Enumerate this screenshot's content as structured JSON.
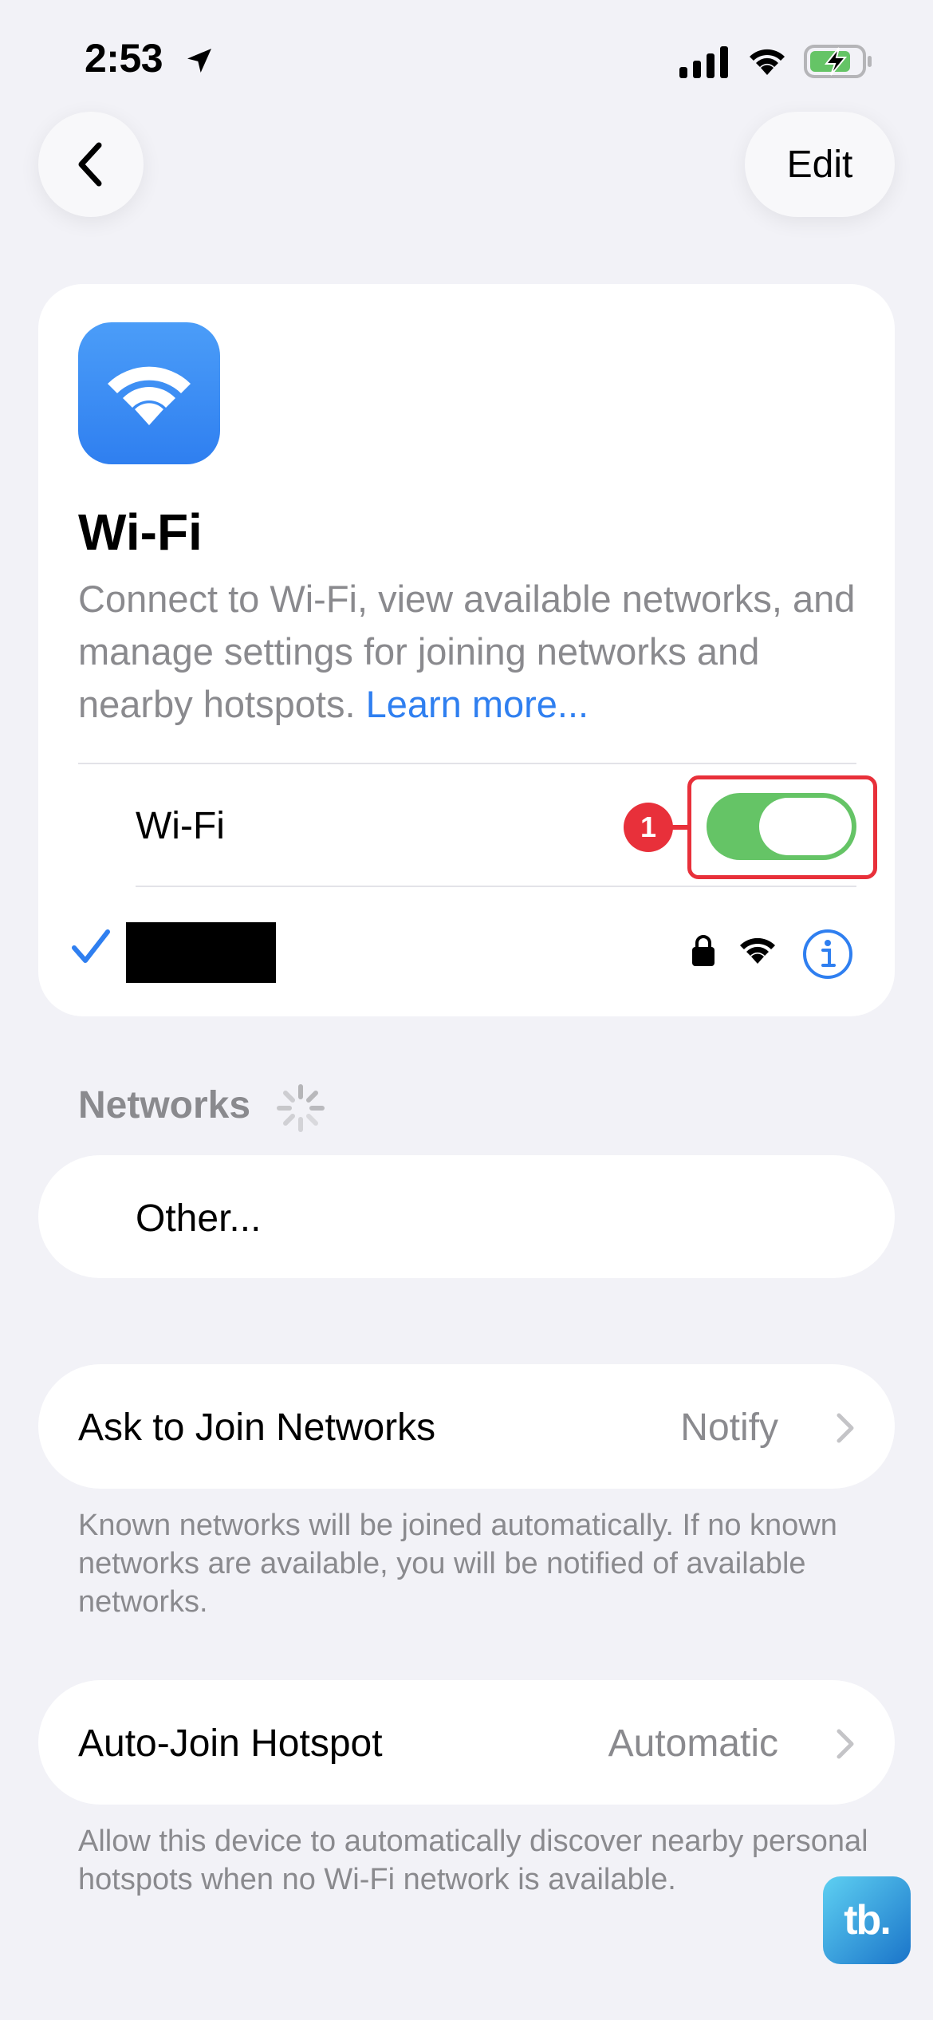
{
  "status_bar": {
    "time": "2:53",
    "icons": [
      "location-arrow-icon",
      "cellular-signal-icon",
      "wifi-icon",
      "battery-charging-icon"
    ]
  },
  "nav": {
    "back_icon": "chevron-left-icon",
    "edit_label": "Edit"
  },
  "wifi_card": {
    "icon": "wifi-icon",
    "title": "Wi-Fi",
    "description": "Connect to Wi-Fi, view available networks, and manage settings for joining networks and nearby hotspots.",
    "learn_more": "Learn more...",
    "toggle_label": "Wi-Fi",
    "toggle_on": true,
    "connected_network": {
      "name_redacted": true,
      "icons": [
        "checkmark-icon",
        "lock-icon",
        "wifi-icon",
        "info-icon"
      ]
    }
  },
  "annotation": {
    "step_number": "1",
    "color": "#E8303A"
  },
  "networks": {
    "header": "Networks",
    "other_label": "Other..."
  },
  "ask_to_join": {
    "label": "Ask to Join Networks",
    "value": "Notify",
    "footer": "Known networks will be joined automatically. If no known networks are available, you will be notified of available networks."
  },
  "auto_join_hotspot": {
    "label": "Auto-Join Hotspot",
    "value": "Automatic",
    "footer": "Allow this device to automatically discover nearby personal hotspots when no Wi-Fi network is available."
  },
  "watermark": {
    "text": "tb."
  },
  "colors": {
    "background": "#F2F2F7",
    "accent_blue": "#2F7FF0",
    "toggle_green": "#65C466",
    "secondary_text": "#8A8A8E"
  }
}
